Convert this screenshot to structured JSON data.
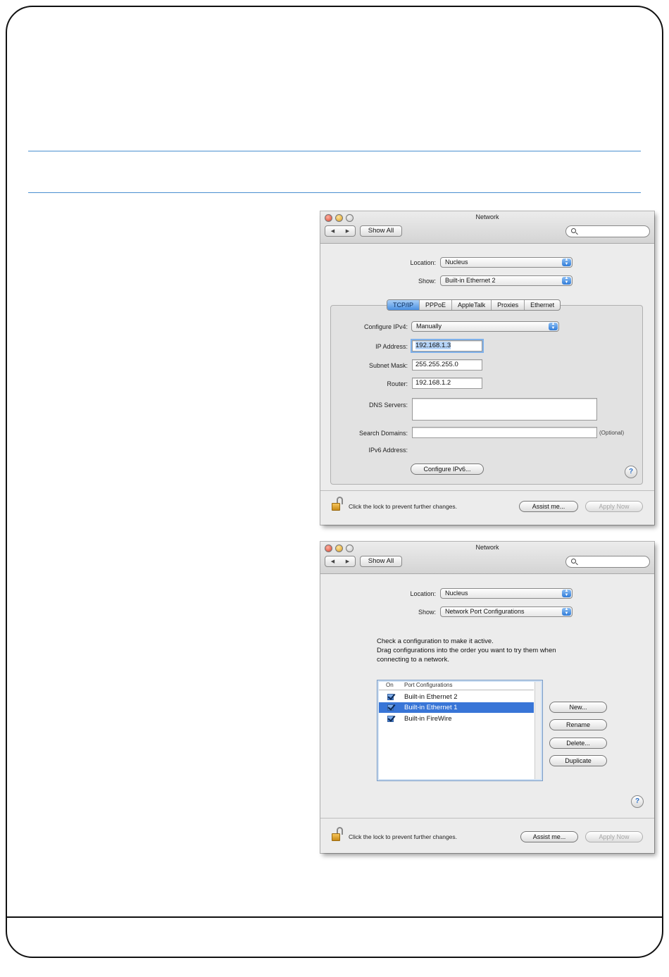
{
  "window_top": {
    "title": "Network",
    "show_all": "Show All",
    "location_label": "Location:",
    "location_value": "Nucleus",
    "show_label": "Show:",
    "show_value": "Built-in Ethernet 2",
    "tabs": [
      "TCP/IP",
      "PPPoE",
      "AppleTalk",
      "Proxies",
      "Ethernet"
    ],
    "active_tab": "TCP/IP",
    "configure_ipv4_label": "Configure IPv4:",
    "configure_ipv4_value": "Manually",
    "ip_address_label": "IP Address:",
    "ip_address_value": "192.168.1.3",
    "subnet_mask_label": "Subnet Mask:",
    "subnet_mask_value": "255.255.255.0",
    "router_label": "Router:",
    "router_value": "192.168.1.2",
    "dns_servers_label": "DNS Servers:",
    "search_domains_label": "Search Domains:",
    "optional_label": "(Optional)",
    "ipv6_address_label": "IPv6 Address:",
    "configure_ipv6_button": "Configure IPv6...",
    "help": "?",
    "lock_text": "Click the lock to prevent further changes.",
    "assist_me_button": "Assist me...",
    "apply_now_button": "Apply Now"
  },
  "window_bottom": {
    "title": "Network",
    "show_all": "Show All",
    "location_label": "Location:",
    "location_value": "Nucleus",
    "show_label": "Show:",
    "show_value": "Network Port Configurations",
    "instructions": [
      "Check a configuration to make it active.",
      "Drag configurations into the order you want to try them when",
      "connecting to a network."
    ],
    "list_header_on": "On",
    "list_header_port": "Port Configurations",
    "ports": [
      {
        "label": "Built-in Ethernet 2",
        "checked": true,
        "selected": false
      },
      {
        "label": "Built-in Ethernet 1",
        "checked": true,
        "selected": true
      },
      {
        "label": "Built-in FireWire",
        "checked": true,
        "selected": false
      }
    ],
    "new_button": "New...",
    "rename_button": "Rename",
    "delete_button": "Delete...",
    "duplicate_button": "Duplicate",
    "help": "?",
    "lock_text": "Click the lock to prevent further changes.",
    "assist_me_button": "Assist me...",
    "apply_now_button": "Apply Now"
  }
}
